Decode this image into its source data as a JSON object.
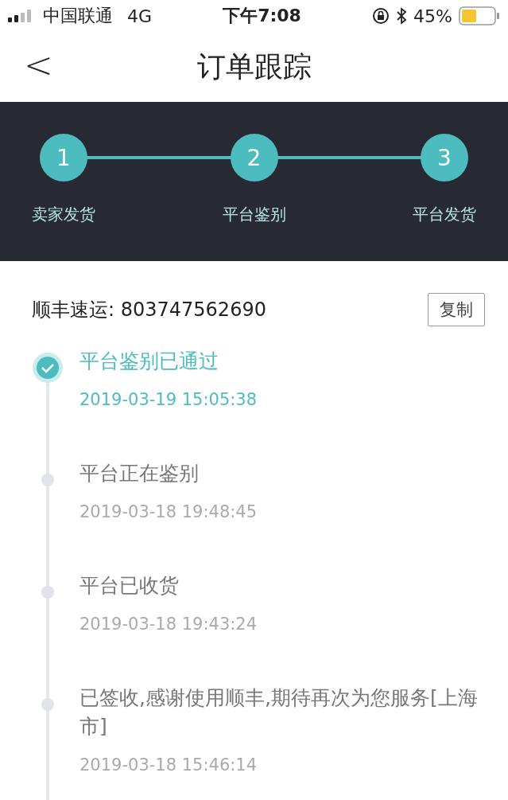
{
  "status_bar": {
    "carrier": "中国联通",
    "network": "4G",
    "time": "下午7:08",
    "battery": "45%"
  },
  "nav": {
    "back": "<",
    "title": "订单跟踪"
  },
  "steps": [
    {
      "number": "1",
      "label": "卖家发货"
    },
    {
      "number": "2",
      "label": "平台鉴别"
    },
    {
      "number": "3",
      "label": "平台发货"
    }
  ],
  "shipment": {
    "carrier_number": "顺丰速运: 803747562690",
    "copy_button": "复制"
  },
  "timeline": [
    {
      "title": "平台鉴别已通过",
      "time": "2019-03-19 15:05:38",
      "active": true
    },
    {
      "title": "平台正在鉴别",
      "time": "2019-03-18 19:48:45",
      "active": false
    },
    {
      "title": "平台已收货",
      "time": "2019-03-18 19:43:24",
      "active": false
    },
    {
      "title": "已签收,感谢使用顺丰,期待再次为您服务[上海市]",
      "time": "2019-03-18 15:46:14",
      "active": false
    }
  ]
}
